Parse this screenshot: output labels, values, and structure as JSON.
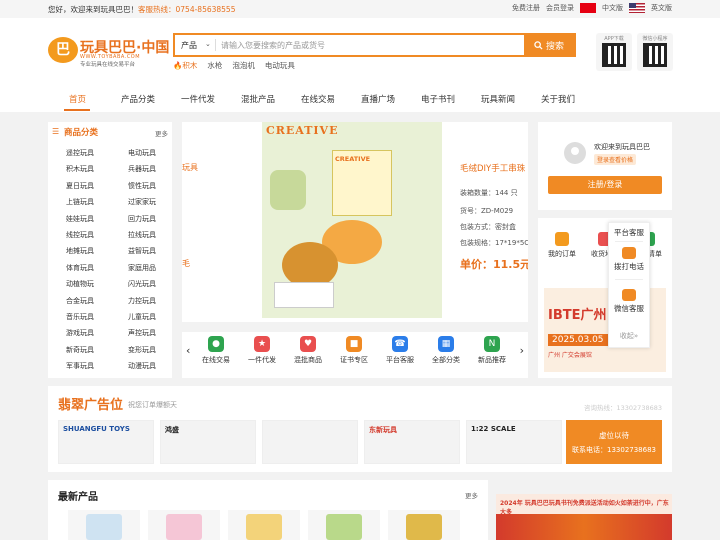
{
  "topbar": {
    "greeting": "您好，欢迎来到玩具巴巴！",
    "hotline": "客服热线：0754-85638555",
    "register": "免费注册",
    "login": "会员登录",
    "lang_cn": "中文版",
    "lang_en": "英文版"
  },
  "logo": {
    "mark": "巴",
    "name": "玩具巴巴·中国",
    "domain": "WWW.TOYBABA.COM",
    "slogan": "专业玩具在线交易平台"
  },
  "search": {
    "category": "产品",
    "arrow": "⌄",
    "placeholder": "请输入您要搜索的产品或货号",
    "button": "搜索",
    "hotwords": [
      "积木",
      "水枪",
      "泡泡机",
      "电动玩具"
    ]
  },
  "qrcodes": [
    {
      "caption": "APP下载"
    },
    {
      "caption": "微信小程序"
    }
  ],
  "nav": {
    "items": [
      "首页",
      "产品分类",
      "一件代发",
      "混批产品",
      "在线交易",
      "直播广场",
      "电子书刊",
      "玩具新闻",
      "关于我们"
    ]
  },
  "sidebar": {
    "title": "商品分类",
    "more": "更多",
    "categories": [
      [
        "遥控玩具",
        "电动玩具"
      ],
      [
        "积木玩具",
        "兵器玩具"
      ],
      [
        "夏日玩具",
        "惯性玩具"
      ],
      [
        "上链玩具",
        "过家家玩"
      ],
      [
        "娃娃玩具",
        "回力玩具"
      ],
      [
        "线控玩具",
        "拉线玩具"
      ],
      [
        "地摊玩具",
        "益智玩具"
      ],
      [
        "体育玩具",
        "家庭用品"
      ],
      [
        "动植物玩",
        "闪光玩具"
      ],
      [
        "合金玩具",
        "力控玩具"
      ],
      [
        "音乐玩具",
        "儿童玩具"
      ],
      [
        "游戏玩具",
        "声控玩具"
      ],
      [
        "新奇玩具",
        "变形玩具"
      ],
      [
        "军事玩具",
        "动漫玩具"
      ]
    ]
  },
  "banner": {
    "brand": "CREATIVE",
    "box_label": "CREATIVE",
    "left_word": "玩具",
    "left_word2": "毛",
    "product_title": "毛绒DIY手工串珠",
    "specs": [
      "装箱数量：144 只",
      "货号：ZD-M029",
      "包装方式：密封盒",
      "包装规格：17*19*5CM"
    ],
    "price": "单价：11.5元"
  },
  "quick_icons": {
    "prev": "‹",
    "next": "›",
    "items": [
      {
        "label": "在线交易",
        "color": "#2ea44f",
        "glyph": "●"
      },
      {
        "label": "一件代发",
        "color": "#e94f4f",
        "glyph": "★"
      },
      {
        "label": "混批商品",
        "color": "#e94f4f",
        "glyph": "♥"
      },
      {
        "label": "证书专区",
        "color": "#f08a24",
        "glyph": "■"
      },
      {
        "label": "平台客服",
        "color": "#2b7de9",
        "glyph": "☎"
      },
      {
        "label": "全部分类",
        "color": "#2b7de9",
        "glyph": "▦"
      },
      {
        "label": "新品推荐",
        "color": "#2ea44f",
        "glyph": "N"
      }
    ]
  },
  "user": {
    "welcome": "欢迎来到玩具巴巴",
    "tag": "登录查看价格",
    "button": "注册/登录"
  },
  "services": {
    "items": [
      "我的订单",
      "收货地址",
      "我的清单"
    ],
    "ad_title": "IBTE广州",
    "ad_date": "2025.03.05",
    "ad_venue": "广州 广交会展馆"
  },
  "float_panel": {
    "items": [
      "平台客服",
      "拨打电话",
      "微信客服"
    ],
    "collapse": "收起»"
  },
  "adsec": {
    "title": "翡翠广告位",
    "subtitle": "祝您订单爆额天",
    "hotline": "咨询热线：13302738683",
    "tiles": [
      {
        "label": "SHUANGFU TOYS",
        "color": "#1d4fa0"
      },
      {
        "label": "鸿盛",
        "color": "#222"
      },
      {
        "label": "",
        "color": "#b0731f"
      },
      {
        "label": "东新玩具",
        "color": "#d33a2c"
      },
      {
        "label": "1:22 SCALE",
        "color": "#222"
      }
    ],
    "cta_a": "虚位以待",
    "cta_b": "联系电话：13302738683"
  },
  "newsec": {
    "title": "最新产品",
    "more": "更多"
  },
  "rightad": {
    "text": "2024年 玩具巴巴玩具书刊免费派送活动如火如荼进行中，广东大多"
  }
}
